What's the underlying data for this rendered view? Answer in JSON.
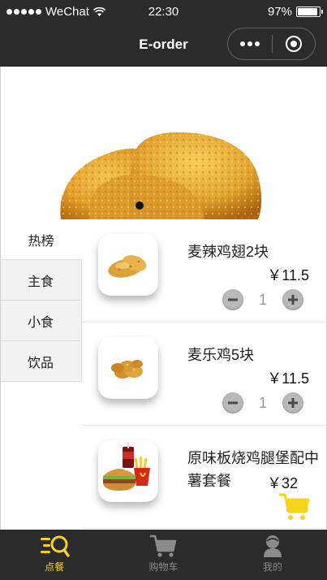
{
  "status_bar": {
    "carrier": "WeChat",
    "time": "22:30",
    "battery": "97%",
    "battery_level": 0.97
  },
  "nav": {
    "title": "E-order"
  },
  "categories": [
    {
      "label": "热榜",
      "active": true
    },
    {
      "label": "主食",
      "active": false
    },
    {
      "label": "小食",
      "active": false
    },
    {
      "label": "饮品",
      "active": false
    }
  ],
  "products": [
    {
      "name": "麦辣鸡翅2块",
      "price": "￥11.5",
      "qty": "1",
      "image": "spicy-wings-image"
    },
    {
      "name": "麦乐鸡5块",
      "price": "￥11.5",
      "qty": "1",
      "image": "nuggets-image"
    },
    {
      "name": "原味板烧鸡腿堡配中薯套餐",
      "price": "￥32",
      "image": "burger-meal-image"
    }
  ],
  "tabbar": {
    "items": [
      {
        "label": "点餐",
        "active": true,
        "icon": "order-icon"
      },
      {
        "label": "购物车",
        "active": false,
        "icon": "cart-icon"
      },
      {
        "label": "我的",
        "active": false,
        "icon": "profile-icon"
      }
    ]
  },
  "colors": {
    "bar_bg": "#2b2b2b",
    "accent": "#f7d41c",
    "inactive": "#8a8a8a"
  }
}
